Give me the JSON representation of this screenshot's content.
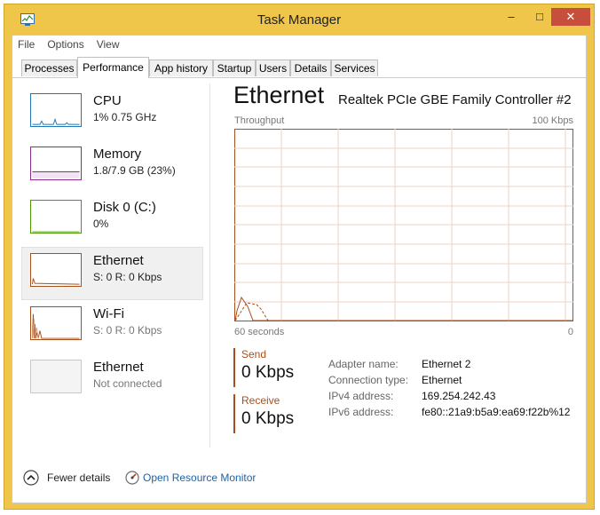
{
  "window": {
    "title": "Task Manager",
    "controls": {
      "minimize": "–",
      "maximize": "□",
      "close": "✕"
    },
    "colors": {
      "frame": "#f0c64a",
      "close": "#c74e3c"
    }
  },
  "menu": [
    "File",
    "Options",
    "View"
  ],
  "tabs": [
    {
      "label": "Processes"
    },
    {
      "label": "Performance",
      "active": true
    },
    {
      "label": "App history"
    },
    {
      "label": "Startup"
    },
    {
      "label": "Users"
    },
    {
      "label": "Details"
    },
    {
      "label": "Services"
    }
  ],
  "sidebar": {
    "items": [
      {
        "name": "CPU",
        "detail": "1% 0.75 GHz",
        "color": "#1f78b4",
        "selected": false,
        "detail_grey": false
      },
      {
        "name": "Memory",
        "detail": "1.8/7.9 GB (23%)",
        "color": "#8b2c8b",
        "selected": false,
        "detail_grey": false
      },
      {
        "name": "Disk 0 (C:)",
        "detail": "0%",
        "color": "#4d9a06",
        "selected": false,
        "detail_grey": false
      },
      {
        "name": "Ethernet",
        "detail": "S: 0 R: 0 Kbps",
        "color": "#a7501b",
        "selected": true,
        "detail_grey": false
      },
      {
        "name": "Wi-Fi",
        "detail": "S: 0 R: 0 Kbps",
        "color": "#a7501b",
        "selected": false,
        "detail_grey": false
      },
      {
        "name": "Ethernet",
        "detail": "Not connected",
        "color": "#c8c8c8",
        "selected": false,
        "detail_grey": true
      }
    ]
  },
  "main": {
    "title": "Ethernet",
    "adapter_name": "Realtek PCIe GBE Family Controller #2",
    "graph": {
      "label": "Throughput",
      "max_label": "100 Kbps",
      "time_label": "60 seconds",
      "min_label": "0",
      "grid_color": "#efd3c4",
      "line_color": "#a7501b"
    },
    "send": {
      "label": "Send",
      "value": "0 Kbps"
    },
    "receive": {
      "label": "Receive",
      "value": "0 Kbps"
    },
    "properties": [
      {
        "key": "Adapter name:",
        "value": "Ethernet 2"
      },
      {
        "key": "Connection type:",
        "value": "Ethernet"
      },
      {
        "key": "IPv4 address:",
        "value": "169.254.242.43"
      },
      {
        "key": "IPv6 address:",
        "value": "fe80::21a9:b5a9:ea69:f22b%12"
      }
    ]
  },
  "footer": {
    "fewer_details": "Fewer details",
    "resource_monitor": "Open Resource Monitor",
    "fewer_icon": "chevron-up-icon",
    "monitor_icon": "resource-monitor-icon"
  }
}
